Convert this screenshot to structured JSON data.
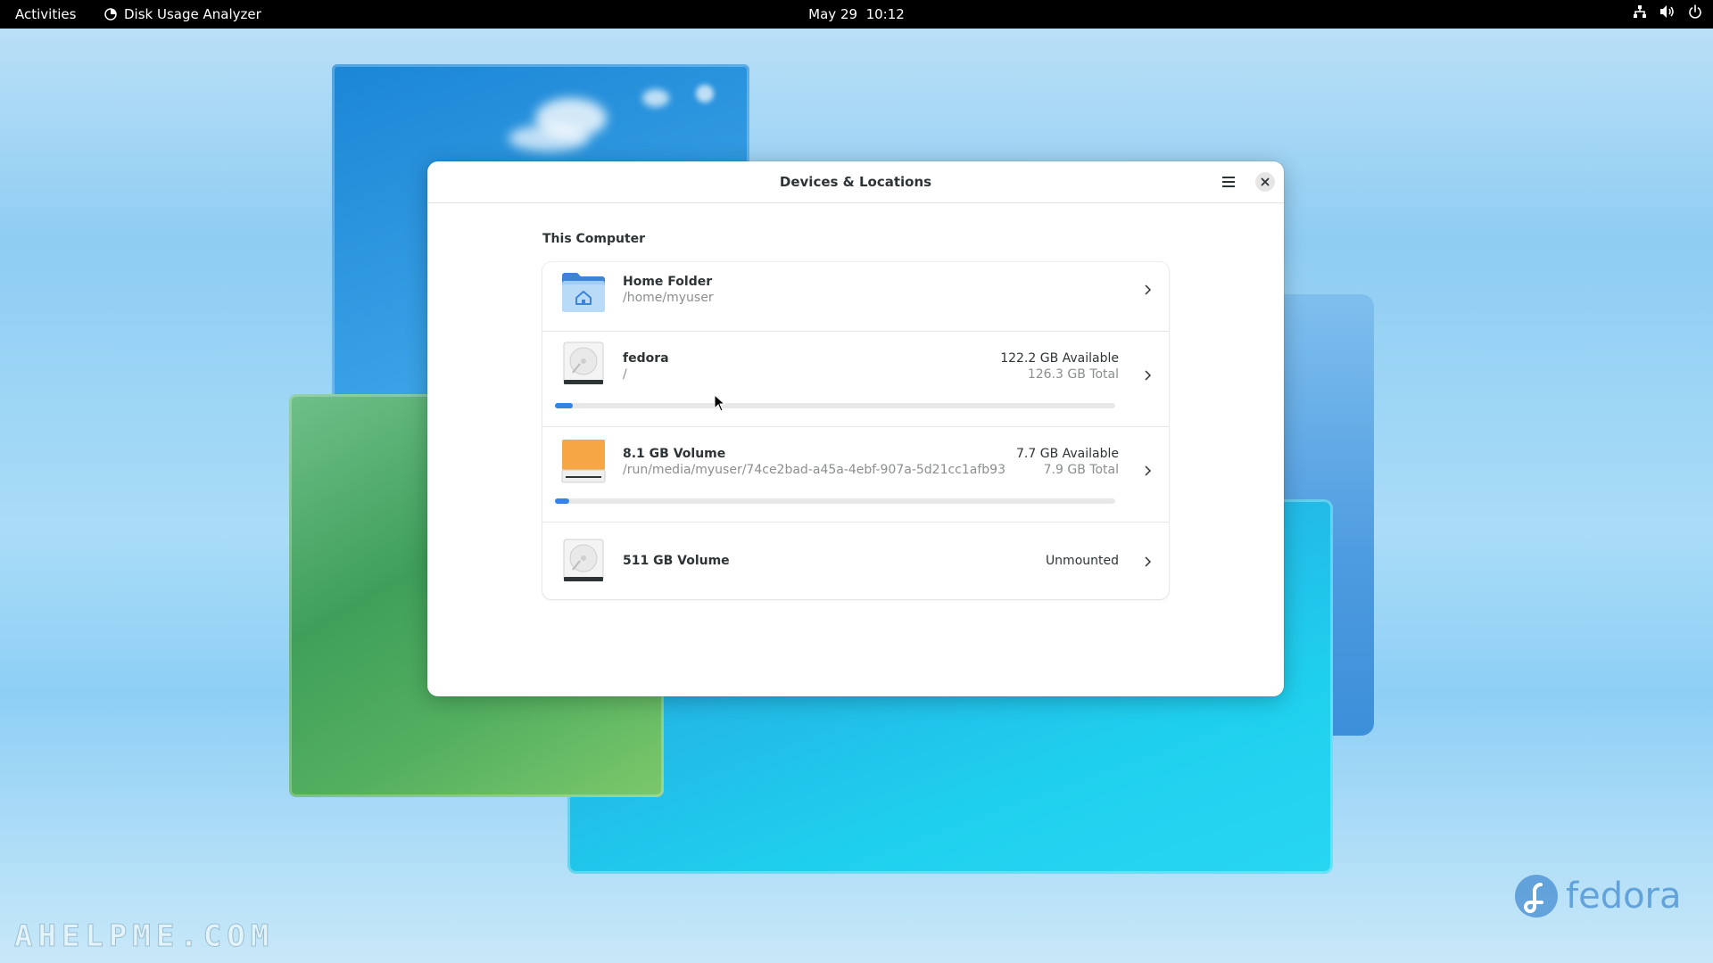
{
  "topbar": {
    "activities": "Activities",
    "app_name": "Disk Usage Analyzer",
    "date": "May 29",
    "time": "10:12",
    "icons": [
      "network-icon",
      "volume-icon",
      "power-icon"
    ]
  },
  "window": {
    "title": "Devices & Locations",
    "menu_icon": "hamburger-menu-icon",
    "close_icon": "close-icon"
  },
  "section": {
    "title": "This Computer"
  },
  "locations": [
    {
      "name": "Home Folder",
      "path": "/home/myuser",
      "icon": "home-folder-icon"
    },
    {
      "name": "fedora",
      "path": "/",
      "available": "122.2 GB Available",
      "total": "126.3 GB Total",
      "usage_fraction": 0.032,
      "icon": "hard-disk-icon"
    },
    {
      "name": "8.1 GB Volume",
      "path": "/run/media/myuser/74ce2bad-a45a-4ebf-907a-5d21cc1afb93",
      "available": "7.7 GB Available",
      "total": "7.9 GB Total",
      "usage_fraction": 0.025,
      "icon": "removable-drive-icon"
    },
    {
      "name": "511 GB Volume",
      "status": "Unmounted",
      "icon": "hard-disk-icon"
    }
  ],
  "wallpaper": {
    "watermark": "AHELPME.COM",
    "logo_text": "fedora"
  },
  "colors": {
    "accent": "#3584e4",
    "folder_blue": "#5aa3ea",
    "drive_orange": "#f6a642"
  }
}
